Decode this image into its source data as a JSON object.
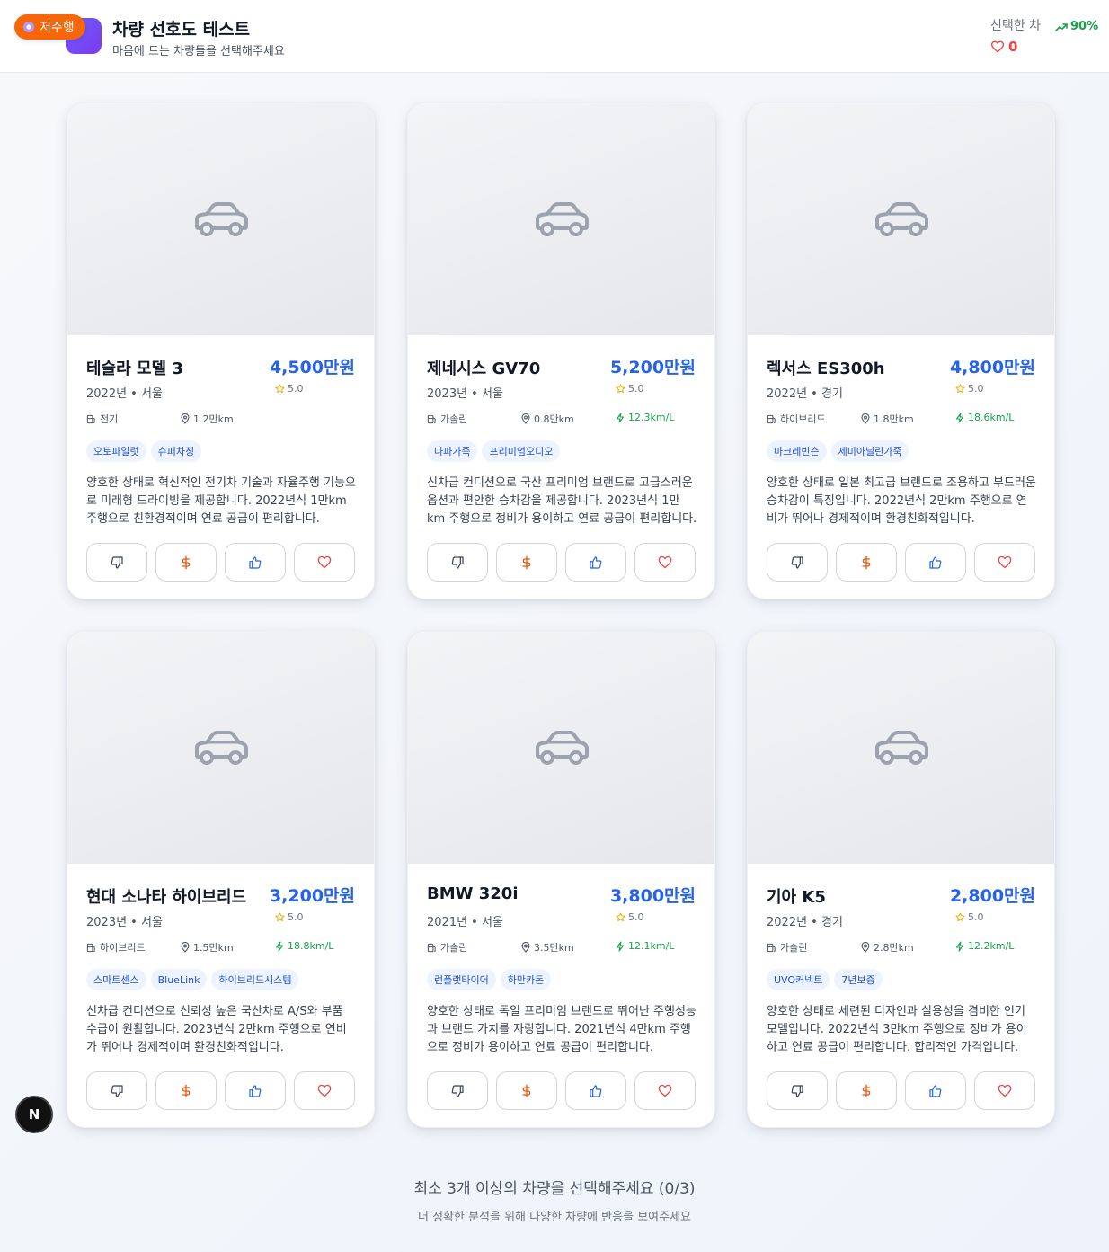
{
  "header": {
    "badge": "저주행",
    "title": "차량 선호도 테스트",
    "subtitle": "마음에 드는 차량들을 선택해주세요",
    "selected_label": "선택한 차",
    "rate": "90%",
    "selected_count": "0"
  },
  "cars": [
    {
      "name": "테슬라 모델 3",
      "price": "4,500만원",
      "rating": "5.0",
      "year": "2022년",
      "region": "서울",
      "fuel": "전기",
      "mileage": "1.2만km",
      "efficiency": "",
      "tags": [
        "오토파일럿",
        "슈퍼차징"
      ],
      "description": "양호한 상태로 혁신적인 전기차 기술과 자율주행 기능으로 미래형 드라이빙을 제공합니다. 2022년식 1만km 주행으로 친환경적이며 연료 공급이 편리합니다."
    },
    {
      "name": "제네시스 GV70",
      "price": "5,200만원",
      "rating": "5.0",
      "year": "2023년",
      "region": "서울",
      "fuel": "가솔린",
      "mileage": "0.8만km",
      "efficiency": "12.3km/L",
      "tags": [
        "나파가죽",
        "프리미엄오디오"
      ],
      "description": "신차급 컨디션으로 국산 프리미엄 브랜드로 고급스러운 옵션과 편안한 승차감을 제공합니다. 2023년식 1만km 주행으로 정비가 용이하고 연료 공급이 편리합니다."
    },
    {
      "name": "렉서스 ES300h",
      "price": "4,800만원",
      "rating": "5.0",
      "year": "2022년",
      "region": "경기",
      "fuel": "하이브리드",
      "mileage": "1.8만km",
      "efficiency": "18.6km/L",
      "tags": [
        "마크레빈슨",
        "세미아닐린가죽"
      ],
      "description": "양호한 상태로 일본 최고급 브랜드로 조용하고 부드러운 승차감이 특징입니다. 2022년식 2만km 주행으로 연비가 뛰어나 경제적이며 환경친화적입니다."
    },
    {
      "name": "현대 소나타 하이브리드",
      "price": "3,200만원",
      "rating": "5.0",
      "year": "2023년",
      "region": "서울",
      "fuel": "하이브리드",
      "mileage": "1.5만km",
      "efficiency": "18.8km/L",
      "tags": [
        "스마트센스",
        "BlueLink",
        "하이브리드시스템"
      ],
      "description": "신차급 컨디션으로 신뢰성 높은 국산차로 A/S와 부품 수급이 원활합니다. 2023년식 2만km 주행으로 연비가 뛰어나 경제적이며 환경친화적입니다."
    },
    {
      "name": "BMW 320i",
      "price": "3,800만원",
      "rating": "5.0",
      "year": "2021년",
      "region": "서울",
      "fuel": "가솔린",
      "mileage": "3.5만km",
      "efficiency": "12.1km/L",
      "tags": [
        "런플랫타이어",
        "하만카돈"
      ],
      "description": "양호한 상태로 독일 프리미엄 브랜드로 뛰어난 주행성능과 브랜드 가치를 자랑합니다. 2021년식 4만km 주행으로 정비가 용이하고 연료 공급이 편리합니다."
    },
    {
      "name": "기아 K5",
      "price": "2,800만원",
      "rating": "5.0",
      "year": "2022년",
      "region": "경기",
      "fuel": "가솔린",
      "mileage": "2.8만km",
      "efficiency": "12.2km/L",
      "tags": [
        "UVO커넥트",
        "7년보증"
      ],
      "description": "양호한 상태로 세련된 디자인과 실용성을 겸비한 인기 모델입니다. 2022년식 3만km 주행으로 정비가 용이하고 연료 공급이 편리합니다. 합리적인 가격입니다."
    }
  ],
  "footer": {
    "main": "최소 3개 이상의 차량을 선택해주세요 (0/3)",
    "sub": "더 정확한 분석을 위해 다양한 차량에 반응을 보여주세요"
  },
  "dev_badge": "N",
  "colors": {
    "accent": "#2563eb",
    "heart": "#ef4444",
    "dollar": "#ea580c",
    "green": "#16a34a",
    "badge": "#f76707"
  }
}
